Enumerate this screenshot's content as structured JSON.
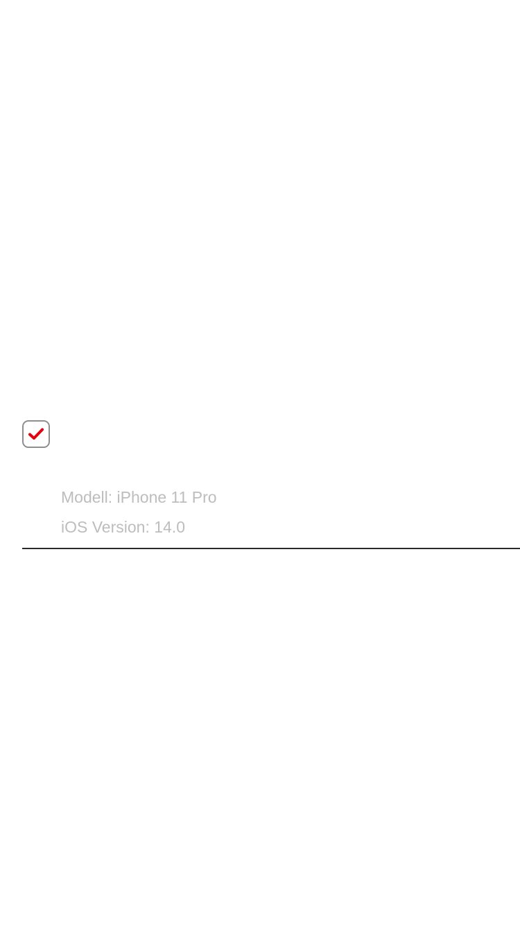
{
  "consent_checkbox": {
    "checked": true,
    "check_color": "#e3000f",
    "icon": "checkmark-icon"
  },
  "device_info": {
    "model": "Modell: iPhone 11 Pro",
    "os_version": "iOS Version: 14.0"
  },
  "colors": {
    "info_text": "#bdbdbd",
    "divider": "#2a2a2a",
    "checkbox_border": "#8e8e8e"
  }
}
